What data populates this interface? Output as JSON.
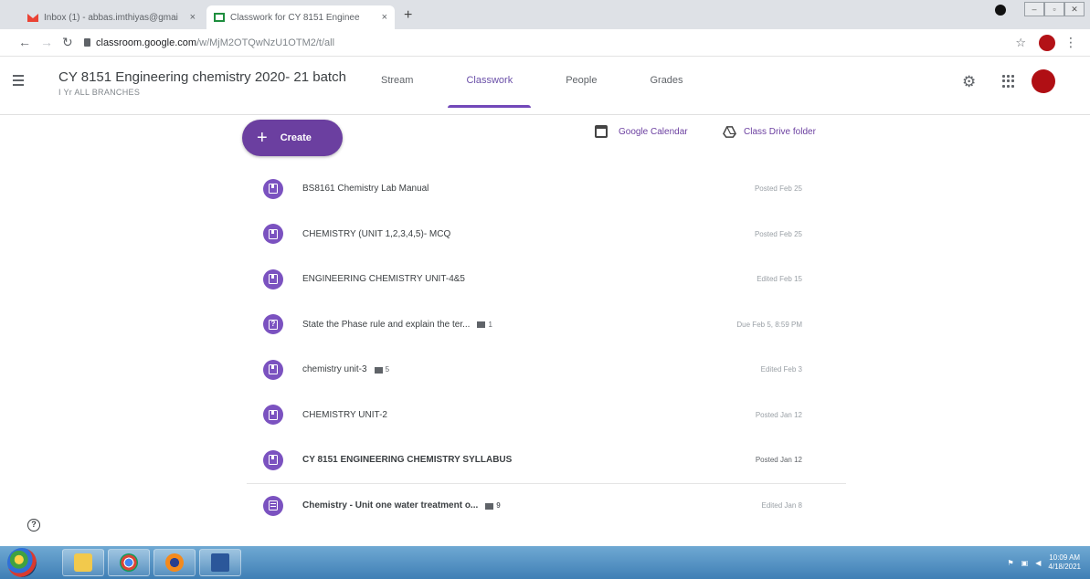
{
  "browser": {
    "tabs": [
      {
        "label": "Inbox (1) - abbas.imthiyas@gmai",
        "close": "×"
      },
      {
        "label": "Classwork for CY 8151 Enginee",
        "close": "×"
      }
    ],
    "new_tab": "+",
    "url_host": "classroom.google.com",
    "url_path": "/w/MjM2OTQwNzU1OTM2/t/all"
  },
  "header": {
    "class_title": "CY 8151 Engineering chemistry 2020- 21 batch",
    "class_subtitle": "I Yr ALL BRANCHES",
    "tabs": [
      {
        "label": "Stream",
        "active": false
      },
      {
        "label": "Classwork",
        "active": true
      },
      {
        "label": "People",
        "active": false
      },
      {
        "label": "Grades",
        "active": false
      }
    ],
    "icons": [
      "settings-gear-icon",
      "apps-grid-icon",
      "account-avatar"
    ]
  },
  "toolbar": {
    "create_label": "Create",
    "calendar_label": "Google Calendar",
    "drive_label": "Class Drive folder"
  },
  "items": [
    {
      "type": "material",
      "title": "BS8161 Chemistry Lab Manual",
      "attachments": "",
      "status": "Posted Feb 25",
      "bold": false
    },
    {
      "type": "material",
      "title": "CHEMISTRY (UNIT 1,2,3,4,5)- MCQ",
      "attachments": "",
      "status": "Posted Feb 25",
      "bold": false
    },
    {
      "type": "material",
      "title": "ENGINEERING CHEMISTRY UNIT-4&5",
      "attachments": "",
      "status": "Edited Feb 15",
      "bold": false
    },
    {
      "type": "question",
      "title": "State the Phase rule and explain the ter...",
      "attachments": "1",
      "status": "Due Feb 5, 8:59 PM",
      "bold": false
    },
    {
      "type": "material",
      "title": "chemistry unit-3",
      "attachments": "5",
      "status": "Edited Feb 3",
      "bold": false
    },
    {
      "type": "material",
      "title": "CHEMISTRY UNIT-2",
      "attachments": "",
      "status": "Posted Jan 12",
      "bold": false
    },
    {
      "type": "material",
      "title": "CY 8151 ENGINEERING CHEMISTRY SYLLABUS",
      "attachments": "",
      "status": "Posted Jan 12",
      "bold": true
    },
    {
      "type": "assignment",
      "title": "Chemistry - Unit one water treatment o...",
      "attachments": "9",
      "status": "Edited Jan 8",
      "bold": true
    }
  ],
  "help_label": "?",
  "taskbar": {
    "clock_time": "10:09 AM",
    "clock_date": "4/18/2021"
  }
}
